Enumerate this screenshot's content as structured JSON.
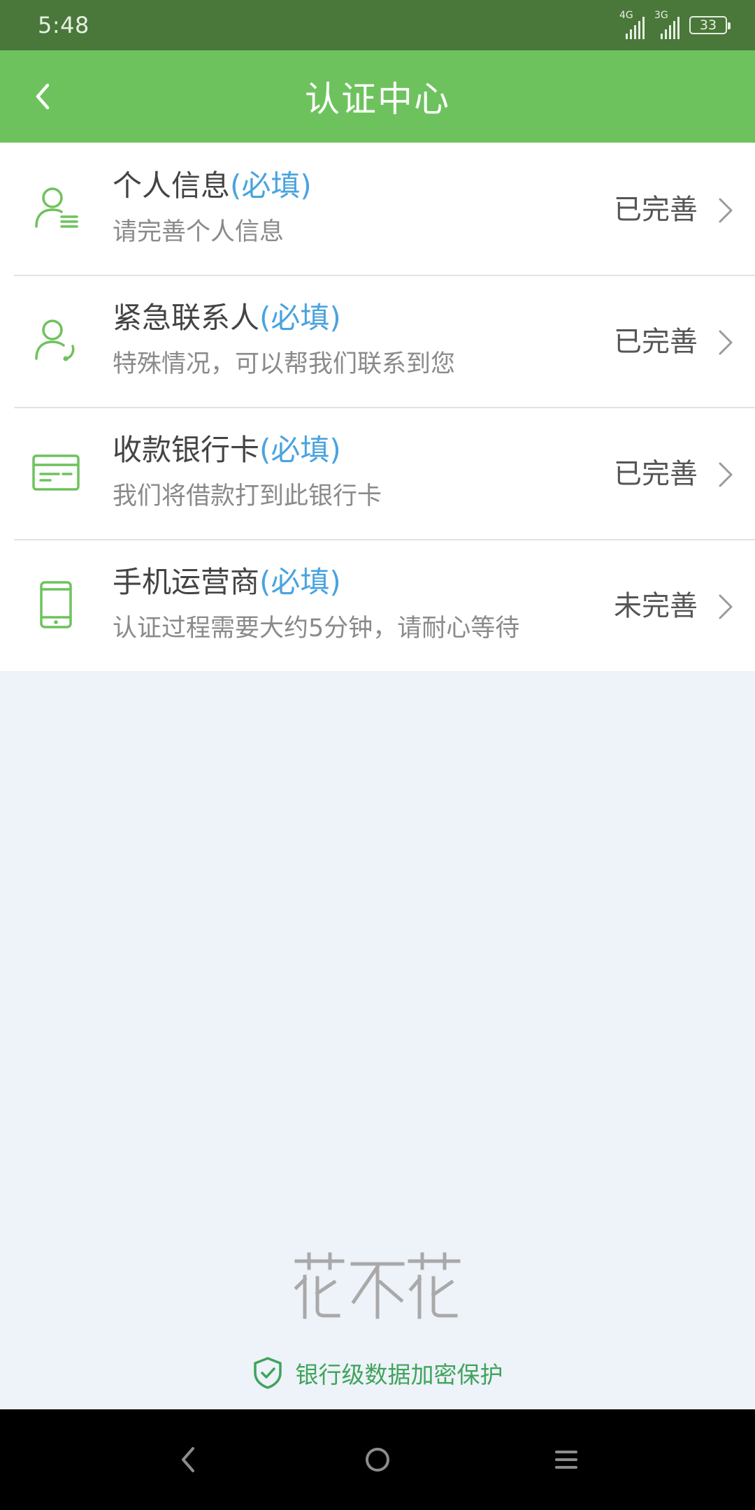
{
  "status_bar": {
    "time": "5:48",
    "network_1": "4G",
    "network_2": "3G",
    "battery": "33"
  },
  "header": {
    "title": "认证中心"
  },
  "items": [
    {
      "title": "个人信息",
      "required": "(必填)",
      "subtitle": "请完善个人信息",
      "status": "已完善",
      "icon": "user-list-icon"
    },
    {
      "title": "紧急联系人",
      "required": "(必填)",
      "subtitle": "特殊情况，可以帮我们联系到您",
      "status": "已完善",
      "icon": "user-phone-icon"
    },
    {
      "title": "收款银行卡",
      "required": "(必填)",
      "subtitle": "我们将借款打到此银行卡",
      "status": "已完善",
      "icon": "bank-card-icon"
    },
    {
      "title": "手机运营商",
      "required": "(必填)",
      "subtitle": "认证过程需要大约5分钟，请耐心等待",
      "status": "未完善",
      "icon": "mobile-phone-icon"
    }
  ],
  "brand": {
    "logo_text": "花不花"
  },
  "footer": {
    "security_text": "银行级数据加密保护"
  },
  "colors": {
    "status_bar": "#4a773a",
    "header": "#6ec25e",
    "accent_green": "#6ec25e",
    "required_blue": "#4aa3df",
    "footer_green": "#3fa45b",
    "background": "#eef2f9"
  }
}
